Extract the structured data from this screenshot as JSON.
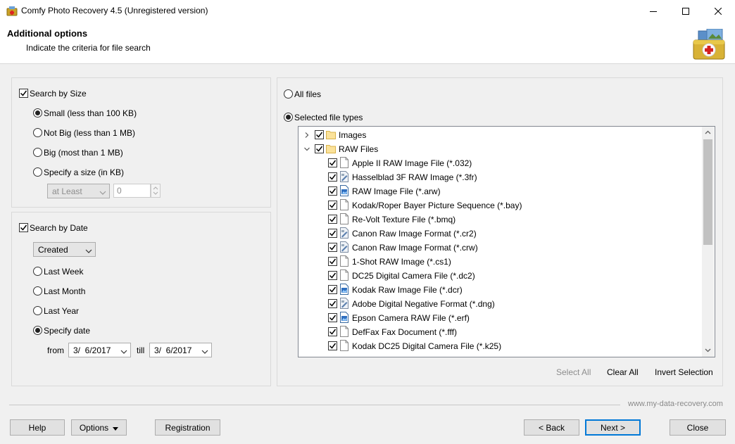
{
  "window": {
    "title": "Comfy Photo Recovery 4.5 (Unregistered version)",
    "minimize_icon": "minimize-icon",
    "maximize_icon": "maximize-icon",
    "close_icon": "close-icon"
  },
  "header": {
    "title": "Additional options",
    "subtitle": "Indicate the criteria for file search",
    "logo_icon": "photo-recovery-case-icon"
  },
  "size_group": {
    "checkbox_label": "Search by Size",
    "checked": true,
    "options": [
      {
        "label": "Small (less than 100 KB)",
        "selected": true
      },
      {
        "label": "Not Big (less than 1 MB)",
        "selected": false
      },
      {
        "label": "Big (most than 1 MB)",
        "selected": false
      },
      {
        "label": "Specify a size (in KB)",
        "selected": false
      }
    ],
    "compare_select": "at Least",
    "size_value": "0"
  },
  "date_group": {
    "checkbox_label": "Search by Date",
    "checked": true,
    "date_type_select": "Created",
    "options": [
      {
        "label": "Last Week",
        "selected": false
      },
      {
        "label": "Last Month",
        "selected": false
      },
      {
        "label": "Last Year",
        "selected": false
      },
      {
        "label": "Specify date",
        "selected": true
      }
    ],
    "from_label": "from",
    "from_value": "3/  6/2017",
    "till_label": "till",
    "till_value": "3/  6/2017"
  },
  "types_group": {
    "all_files_label": "All files",
    "all_files_selected": false,
    "selected_types_label": "Selected file types",
    "selected_types_selected": true,
    "tree": [
      {
        "label": "Images",
        "level": 0,
        "expanded": false,
        "checked": true,
        "icon": "folder-icon"
      },
      {
        "label": "RAW Files",
        "level": 0,
        "expanded": true,
        "checked": true,
        "icon": "folder-icon"
      },
      {
        "label": "Apple II RAW Image File (*.032)",
        "level": 1,
        "checked": true,
        "icon": "document-icon"
      },
      {
        "label": "Hasselblad 3F RAW Image (*.3fr)",
        "level": 1,
        "checked": true,
        "icon": "raw-image-icon"
      },
      {
        "label": "RAW Image File (*.arw)",
        "level": 1,
        "checked": true,
        "icon": "image-file-icon"
      },
      {
        "label": "Kodak/Roper Bayer Picture Sequence (*.bay)",
        "level": 1,
        "checked": true,
        "icon": "document-icon"
      },
      {
        "label": "Re-Volt Texture File (*.bmq)",
        "level": 1,
        "checked": true,
        "icon": "document-icon"
      },
      {
        "label": "Canon Raw Image Format (*.cr2)",
        "level": 1,
        "checked": true,
        "icon": "raw-image-icon"
      },
      {
        "label": "Canon Raw Image Format (*.crw)",
        "level": 1,
        "checked": true,
        "icon": "raw-image-icon"
      },
      {
        "label": "1-Shot RAW Image (*.cs1)",
        "level": 1,
        "checked": true,
        "icon": "document-icon"
      },
      {
        "label": "DC25 Digital Camera File (*.dc2)",
        "level": 1,
        "checked": true,
        "icon": "document-icon"
      },
      {
        "label": "Kodak Raw Image File (*.dcr)",
        "level": 1,
        "checked": true,
        "icon": "image-file-icon"
      },
      {
        "label": "Adobe Digital Negative Format (*.dng)",
        "level": 1,
        "checked": true,
        "icon": "raw-image-icon"
      },
      {
        "label": "Epson Camera RAW File (*.erf)",
        "level": 1,
        "checked": true,
        "icon": "image-file-icon"
      },
      {
        "label": "DefFax Fax Document (*.fff)",
        "level": 1,
        "checked": true,
        "icon": "document-icon"
      },
      {
        "label": "Kodak DC25 Digital Camera File (*.k25)",
        "level": 1,
        "checked": true,
        "icon": "document-icon"
      }
    ],
    "select_all": "Select All",
    "clear_all": "Clear All",
    "invert_selection": "Invert Selection"
  },
  "footer": {
    "website": "www.my-data-recovery.com",
    "help": "Help",
    "options": "Options",
    "registration": "Registration",
    "back": "< Back",
    "next": "Next >",
    "close": "Close"
  }
}
